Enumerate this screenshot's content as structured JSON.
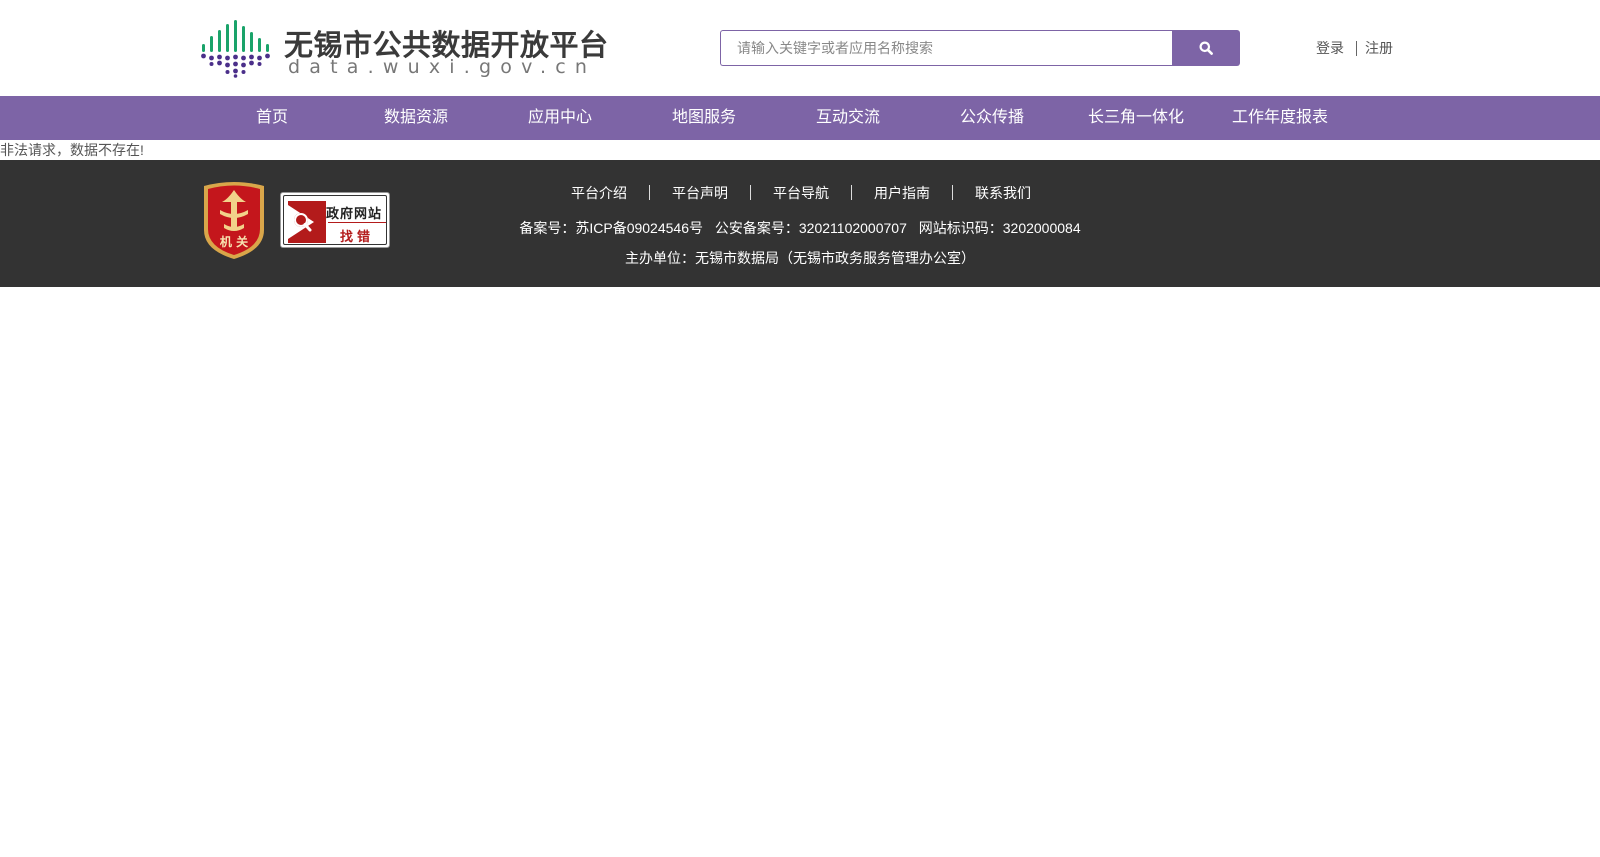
{
  "header": {
    "logo_title": "无锡市公共数据开放平台",
    "logo_subtitle": "data.wuxi.gov.cn",
    "search_placeholder": "请输入关键字或者应用名称搜索",
    "search_icon": "search-icon",
    "login": "登录",
    "register": "注册"
  },
  "nav": {
    "items": [
      "首页",
      "数据资源",
      "应用中心",
      "地图服务",
      "互动交流",
      "公众传播",
      "长三角一体化",
      "工作年度报表"
    ]
  },
  "message": "非法请求，数据不存在!",
  "footer": {
    "links": [
      "平台介绍",
      "平台声明",
      "平台导航",
      "用户指南",
      "联系我们"
    ],
    "icp": "备案号：苏ICP备09024546号",
    "police": "公安备案号：32021102000707",
    "site_id": "网站标识码：3202000084",
    "sponsor": "主办单位：无锡市数据局（无锡市政务服务管理办公室）",
    "badge_text": "机 关",
    "jiucuo_top": "政府网站",
    "jiucuo_bottom": "找错"
  },
  "colors": {
    "brand_purple": "#7d64a6",
    "footer_bg": "#333333",
    "logo_green": "#1aa36a",
    "logo_purple": "#4b2f8a"
  }
}
